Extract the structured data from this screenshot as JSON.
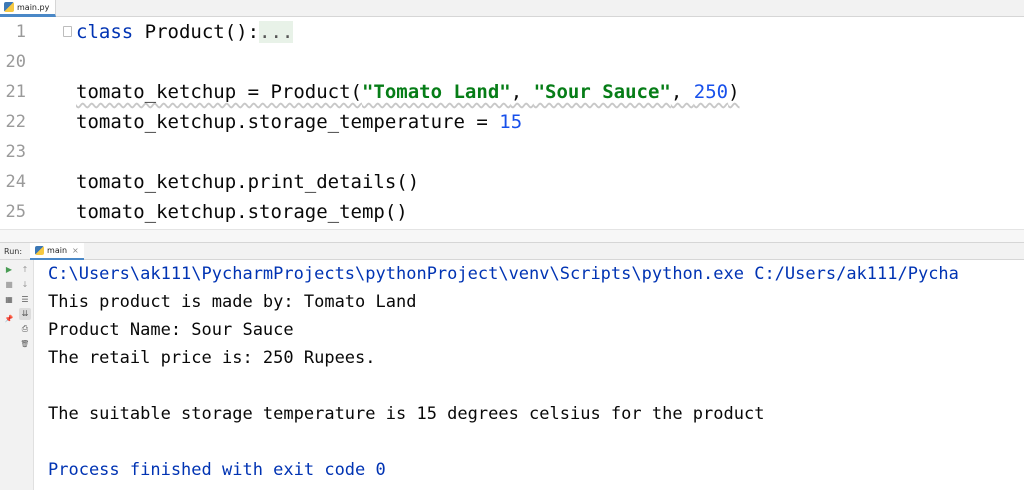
{
  "editor_tab": {
    "filename": "main.py"
  },
  "editor": {
    "lines": [
      {
        "num": "1",
        "parts": [
          {
            "t": "kw",
            "v": "class"
          },
          {
            "t": "txt",
            "v": " Product():"
          },
          {
            "t": "fold",
            "v": "..."
          }
        ]
      },
      {
        "num": "20",
        "parts": []
      },
      {
        "num": "21",
        "parts": [
          {
            "t": "txt",
            "v": "tomato_ketchup = Product("
          },
          {
            "t": "str",
            "v": "\"Tomato Land\""
          },
          {
            "t": "txt",
            "v": ", "
          },
          {
            "t": "str",
            "v": "\"Sour Sauce\""
          },
          {
            "t": "txt",
            "v": ", "
          },
          {
            "t": "num",
            "v": "250"
          },
          {
            "t": "txt",
            "v": ")"
          }
        ]
      },
      {
        "num": "22",
        "parts": [
          {
            "t": "txt",
            "v": "tomato_ketchup.storage_temperature = "
          },
          {
            "t": "num",
            "v": "15"
          }
        ]
      },
      {
        "num": "23",
        "parts": []
      },
      {
        "num": "24",
        "parts": [
          {
            "t": "txt",
            "v": "tomato_ketchup.print_details()"
          }
        ]
      },
      {
        "num": "25",
        "parts": [
          {
            "t": "txt",
            "v": "tomato_ketchup.storage_temp()"
          }
        ]
      }
    ]
  },
  "run": {
    "title": "Run:",
    "tab_label": "main",
    "tab_close": "×",
    "toolbar_icons": {
      "rerun": "▶",
      "stop": "■",
      "up": "↑",
      "down": "↓",
      "soft_wrap": "☰",
      "scroll_end": "⇊",
      "print": "⎙",
      "trash": "🗑",
      "layout": "▦",
      "pin": "📌"
    },
    "console": [
      {
        "text": "C:\\Users\\ak111\\PycharmProjects\\pythonProject\\venv\\Scripts\\python.exe C:/Users/ak111/Pycha",
        "style": "cmd"
      },
      {
        "text": "This product is made by: Tomato Land",
        "style": "out"
      },
      {
        "text": "Product Name: Sour Sauce",
        "style": "out"
      },
      {
        "text": "The retail price is: 250 Rupees.",
        "style": "out"
      },
      {
        "text": "",
        "style": "out"
      },
      {
        "text": "The suitable storage temperature is 15 degrees celsius for the product",
        "style": "out"
      },
      {
        "text": "",
        "style": "out"
      },
      {
        "text": "Process finished with exit code 0",
        "style": "process"
      }
    ]
  },
  "colors": {
    "keyword": "#0033b3",
    "string": "#067d17",
    "number": "#1750eb",
    "run_green": "#499c54",
    "stop_gray": "#a8a8a8"
  }
}
